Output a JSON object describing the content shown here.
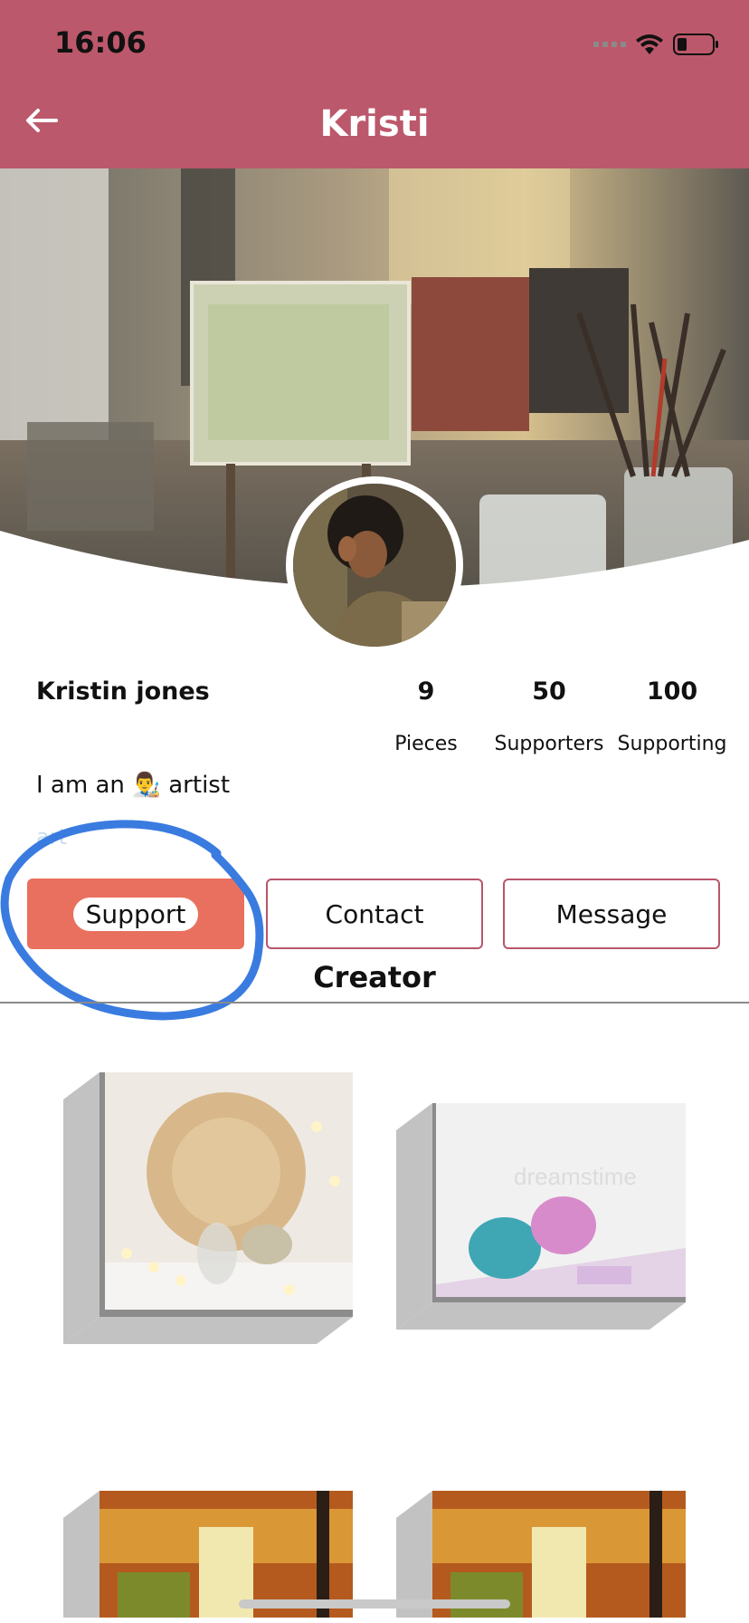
{
  "status_bar": {
    "time": "16:06"
  },
  "header": {
    "title": "Kristi",
    "back_icon": "arrow-left-icon"
  },
  "colors": {
    "header_bg": "#bc586b",
    "support_bg": "#e9705e",
    "button_border": "#b8566a",
    "annotation": "#3a7be0"
  },
  "profile": {
    "name": "Kristin jones",
    "stats": [
      {
        "value": "9",
        "label": "Pieces"
      },
      {
        "value": "50",
        "label": "Supporters"
      },
      {
        "value": "100",
        "label": "Supporting"
      }
    ],
    "bio_prefix": "I am an",
    "bio_emoji": "👨‍🎨",
    "bio_suffix": "artist",
    "bio_tag": "art"
  },
  "actions": {
    "support": "Support",
    "contact": "Contact",
    "message": "Message"
  },
  "section_title": "Creator",
  "gallery": [
    {
      "name": "vase-lights-artwork"
    },
    {
      "name": "yarn-balls-artwork",
      "watermark": "dreamstime"
    },
    {
      "name": "autumn-forest-artwork"
    },
    {
      "name": "autumn-forest-artwork-2"
    }
  ]
}
